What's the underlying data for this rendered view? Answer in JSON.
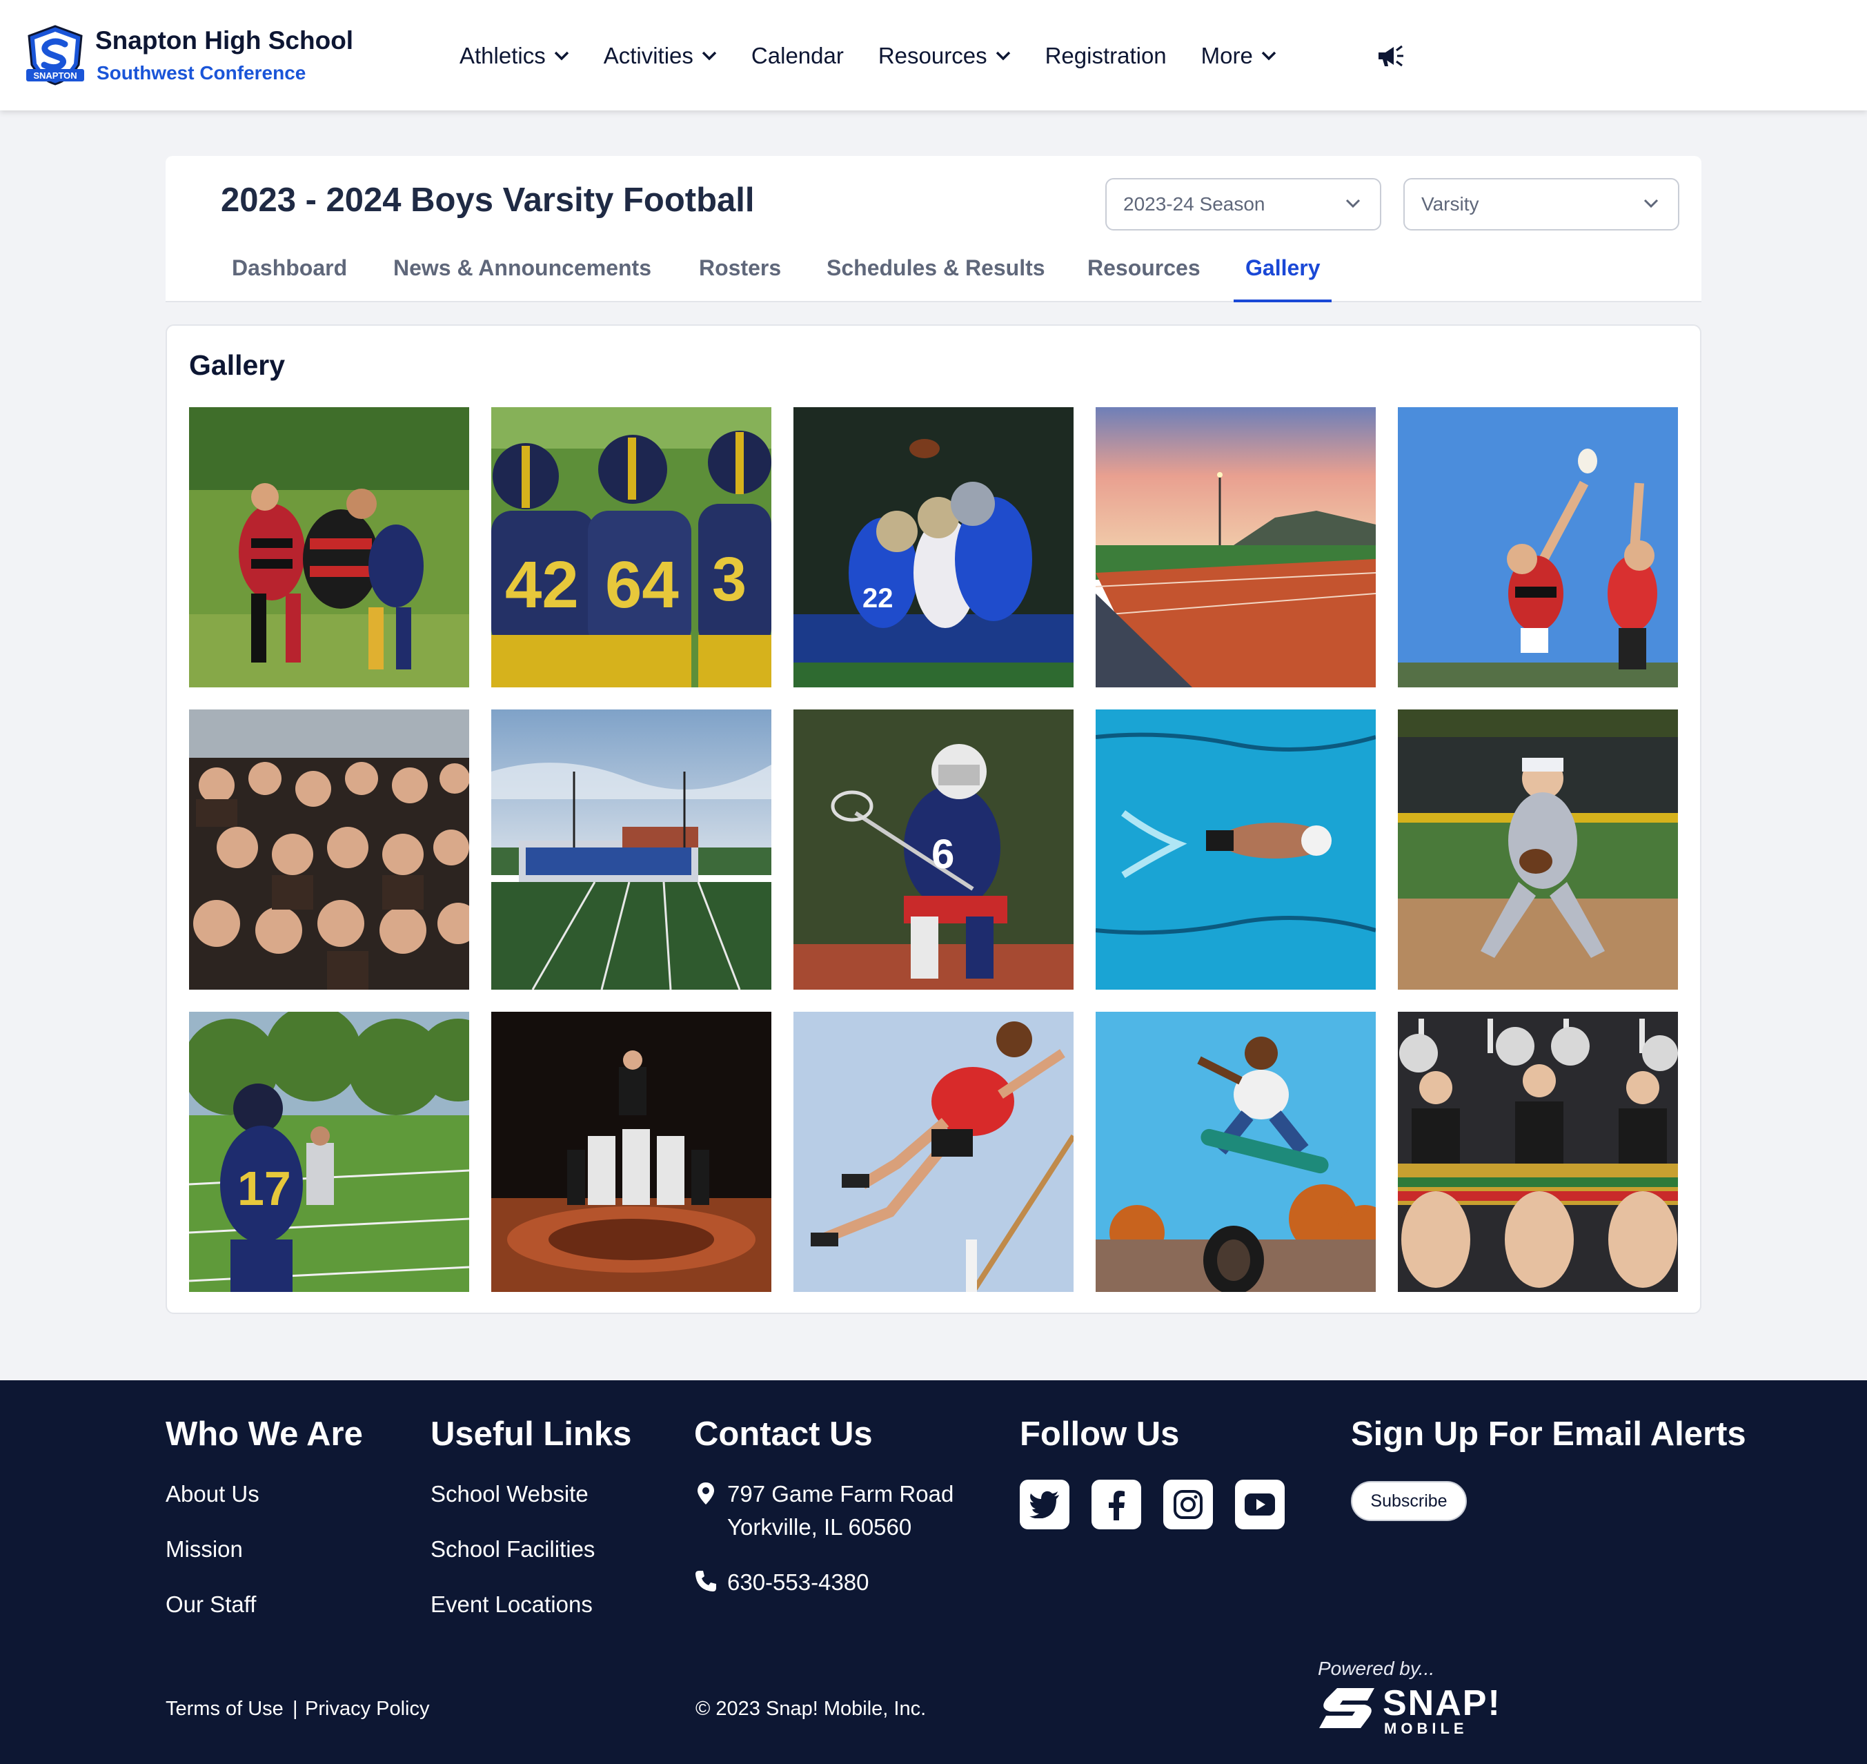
{
  "header": {
    "school_name": "Snapton High School",
    "conference": "Southwest Conference",
    "logo_text": "SNAPTON",
    "nav": [
      {
        "label": "Athletics",
        "has_dropdown": true
      },
      {
        "label": "Activities",
        "has_dropdown": true
      },
      {
        "label": "Calendar",
        "has_dropdown": false
      },
      {
        "label": "Resources",
        "has_dropdown": true
      },
      {
        "label": "Registration",
        "has_dropdown": false
      },
      {
        "label": "More",
        "has_dropdown": true
      }
    ],
    "announcement_icon": "megaphone-icon"
  },
  "team": {
    "title": "2023 - 2024 Boys Varsity Football",
    "season_select": "2023-24 Season",
    "level_select": "Varsity",
    "tabs": [
      {
        "label": "Dashboard",
        "active": false
      },
      {
        "label": "News & Announcements",
        "active": false
      },
      {
        "label": "Rosters",
        "active": false
      },
      {
        "label": "Schedules & Results",
        "active": false
      },
      {
        "label": "Resources",
        "active": false
      },
      {
        "label": "Gallery",
        "active": true
      }
    ]
  },
  "gallery": {
    "title": "Gallery",
    "photos": [
      "rugby-tackle-photo",
      "football-players-back-photo",
      "football-catch-photo",
      "stadium-sunset-photo",
      "rugby-lineout-photo",
      "student-crowd-photo",
      "football-stadium-photo",
      "lacrosse-player-photo",
      "swimmer-photo",
      "baseball-infielder-photo",
      "football-player-17-photo",
      "cheer-pyramid-photo",
      "high-jump-photo",
      "skateboarder-photo",
      "cheerleaders-photo"
    ]
  },
  "footer": {
    "who_we_are": {
      "heading": "Who We Are",
      "links": [
        "About Us",
        "Mission",
        "Our Staff"
      ]
    },
    "useful_links": {
      "heading": "Useful Links",
      "links": [
        "School Website",
        "School Facilities",
        "Event Locations"
      ]
    },
    "contact": {
      "heading": "Contact Us",
      "address_line1": "797 Game Farm Road",
      "address_line2": "Yorkville, IL 60560",
      "phone": "630-553-4380"
    },
    "follow": {
      "heading": "Follow Us",
      "icons": [
        "twitter-icon",
        "facebook-icon",
        "instagram-icon",
        "youtube-icon"
      ]
    },
    "email_alerts": {
      "heading": "Sign Up For Email Alerts",
      "button": "Subscribe"
    },
    "terms": "Terms of Use",
    "separator": "|",
    "privacy": "Privacy Policy",
    "copyright": "© 2023 Snap! Mobile, Inc.",
    "powered_by": "Powered by...",
    "brand": "SNAP!",
    "brand_sub": "MOBILE"
  },
  "colors": {
    "accent": "#1a48d6",
    "footer_bg": "#0d1733",
    "page_bg": "#f2f3f6"
  }
}
